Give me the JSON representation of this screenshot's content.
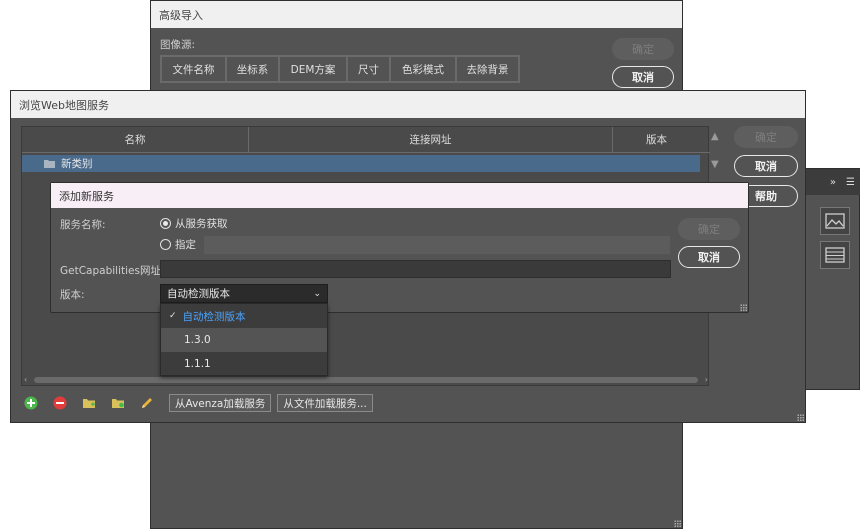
{
  "advanced_import": {
    "title": "高级导入",
    "image_source_label": "图像源:",
    "tabs": [
      "文件名称",
      "坐标系",
      "DEM方案",
      "尺寸",
      "色彩模式",
      "去除背景"
    ],
    "ok_label": "确定",
    "cancel_label": "取消"
  },
  "browse_dialog": {
    "title": "浏览Web地图服务",
    "columns": [
      "名称",
      "连接网址",
      "版本"
    ],
    "rows": [
      {
        "name": "新类别",
        "folder_icon": "folder-icon"
      }
    ],
    "ok_label": "确定",
    "cancel_label": "取消",
    "help_label": "帮助",
    "load_avenza_label": "从Avenza加载服务",
    "load_file_label": "从文件加载服务...",
    "toolbar_icons": [
      "add-icon",
      "remove-icon",
      "new-folder-icon",
      "folder-star-icon",
      "pencil-icon"
    ]
  },
  "add_service": {
    "title": "添加新服务",
    "service_name_label": "服务名称:",
    "radio_from_service": "从服务获取",
    "radio_specify": "指定",
    "radio_selected": "from_service",
    "getcap_label": "GetCapabilities网址:",
    "getcap_value": "",
    "version_label": "版本:",
    "version_selected": "自动检测版本",
    "ok_label": "确定",
    "cancel_label": "取消"
  },
  "version_dropdown": {
    "options": [
      "自动检测版本",
      "1.3.0",
      "1.1.1"
    ],
    "selected_index": 0
  },
  "colors": {
    "selected_row": "#4a6a8c",
    "dropdown_selected_text": "#4aa3ff",
    "add_icon": "#4cb84c",
    "remove_icon": "#e03c3c",
    "folder_icon": "#d8c05a"
  }
}
